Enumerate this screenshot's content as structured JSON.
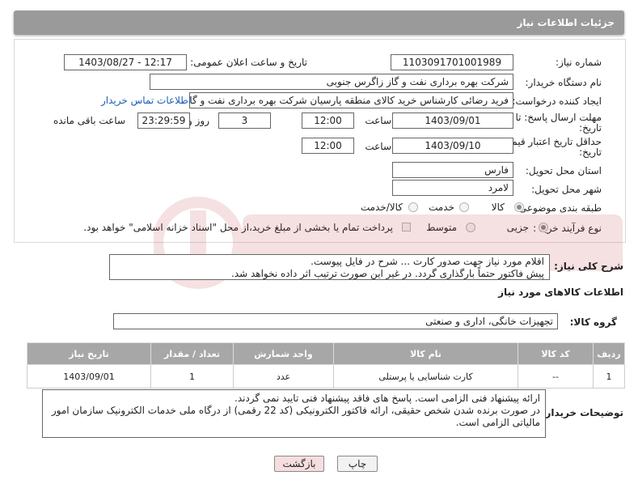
{
  "header": {
    "title": "جزئیات اطلاعات نیاز"
  },
  "form": {
    "need_number": {
      "label": "شماره نیاز:",
      "value": "1103091701001989"
    },
    "announce_datetime": {
      "label": "تاریخ و ساعت اعلان عمومی:",
      "value": "1403/08/27 - 12:17"
    },
    "buyer_org": {
      "label": "نام دستگاه خریدار:",
      "value": "شرکت بهره برداری نفت و گاز زاگرس جنوبی"
    },
    "requester": {
      "label": "ایجاد کننده درخواست:",
      "value": "فرید رضائی کارشناس خرید کالای منطقه پارسیان شرکت بهره برداری نفت و گاز",
      "contact_link": "اطلاعات تماس خریدار"
    },
    "reply_deadline": {
      "label_line1": "مهلت ارسال پاسخ: تا",
      "label_line2": "تاریخ:",
      "date": "1403/09/01",
      "time_label": "ساعت",
      "time": "12:00",
      "days": "3",
      "days_label": "روز و",
      "remaining": "23:29:59",
      "remaining_label": "ساعت باقی مانده"
    },
    "price_validity": {
      "label_line1": "حداقل تاریخ اعتبار قیمت: تا",
      "label_line2": "تاریخ:",
      "date": "1403/09/10",
      "time_label": "ساعت",
      "time": "12:00"
    },
    "province": {
      "label": "استان محل تحویل:",
      "value": "فارس"
    },
    "city": {
      "label": "شهر محل تحویل:",
      "value": "لامرد"
    },
    "category": {
      "label": "طبقه بندی موضوعی:",
      "options": [
        "کالا",
        "خدمت",
        "کالا/خدمت"
      ],
      "selected": "کالا"
    },
    "process_type": {
      "label": "نوع فرآیند خرید :",
      "options": [
        "جزیی",
        "متوسط"
      ],
      "selected": "جزیی",
      "payment_note": "پرداخت تمام یا بخشی از مبلغ خرید،از محل \"اسناد خزانه اسلامی\" خواهد بود."
    }
  },
  "description": {
    "label": "شرح کلی نیاز:",
    "line1": "اقلام مورد نیاز جهت صدور کارت ... شرح در فایل پیوست.",
    "line2": "پیش فاکتور حتماً بارگذاری گردد. در غیر این صورت ترتیب اثر داده نخواهد شد."
  },
  "goods_section": {
    "title": "اطلاعات کالاهای مورد نیاز"
  },
  "goods_group": {
    "label": "گروه کالا:",
    "value": "تجهیزات خانگی، اداری و صنعتی"
  },
  "table": {
    "headers": [
      "ردیف",
      "کد کالا",
      "نام کالا",
      "واحد شمارش",
      "تعداد / مقدار",
      "تاریخ نیاز"
    ],
    "rows": [
      [
        "1",
        "--",
        "کارت شناسایی یا پرستلی",
        "عدد",
        "1",
        "1403/09/01"
      ]
    ]
  },
  "buyer_notes": {
    "label": "توضیحات خریدار:",
    "line1": "ارائه پیشنهاد فنی الزامی است. پاسخ های فاقد پیشنهاد فنی تایید نمی گردند.",
    "line2": "در صورت برنده شدن شخص حقیقی، ارائه فاکتور الکترونیکی (کد 22 رقمی) از درگاه ملی خدمات الکترونیک سازمان امور",
    "line3": "مالیاتی الزامی است."
  },
  "buttons": {
    "print": "چاپ",
    "back": "بازگشت"
  },
  "colors": {
    "header_bg": "#9a9a9a",
    "table_header_bg": "#a7a7a7",
    "link": "#1a5fb4",
    "back_button_bg": "#f6dede"
  }
}
